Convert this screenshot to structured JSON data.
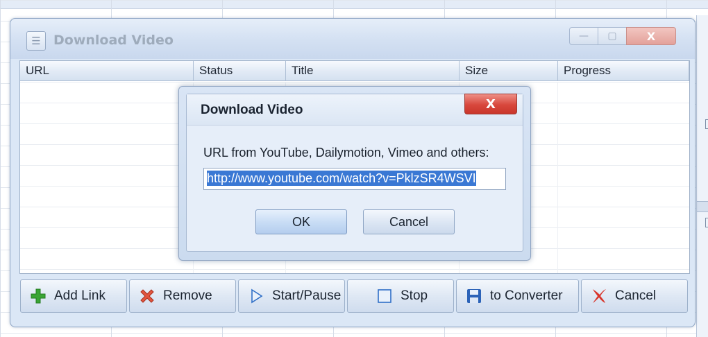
{
  "main_window": {
    "title": "Download Video",
    "title_icon": "window-menu-icon",
    "window_buttons": {
      "minimize": "—",
      "maximize": "▢",
      "close": "X"
    }
  },
  "list": {
    "columns": [
      "URL",
      "Status",
      "Title",
      "Size",
      "Progress"
    ]
  },
  "toolbar": {
    "add_link": "Add Link",
    "remove": "Remove",
    "start_pause": "Start/Pause",
    "stop": "Stop",
    "to_converter": "to Converter",
    "cancel": "Cancel"
  },
  "icons": {
    "add": "plus-icon",
    "remove": "x-cross-icon",
    "start": "play-triangle-icon",
    "stop": "stop-square-icon",
    "converter": "floppy-disk-icon",
    "cancel": "x-cross-icon"
  },
  "dialog": {
    "title": "Download Video",
    "close_label": "X",
    "prompt": "URL from YouTube, Dailymotion, Vimeo and others:",
    "url_value": "http://www.youtube.com/watch?v=PklzSR4WSVI",
    "ok_label": "OK",
    "cancel_label": "Cancel"
  },
  "colors": {
    "accent_green": "#2e9a2a",
    "accent_red": "#d23a2f",
    "accent_blue": "#2f6fc7",
    "selection": "#3a78d4"
  }
}
